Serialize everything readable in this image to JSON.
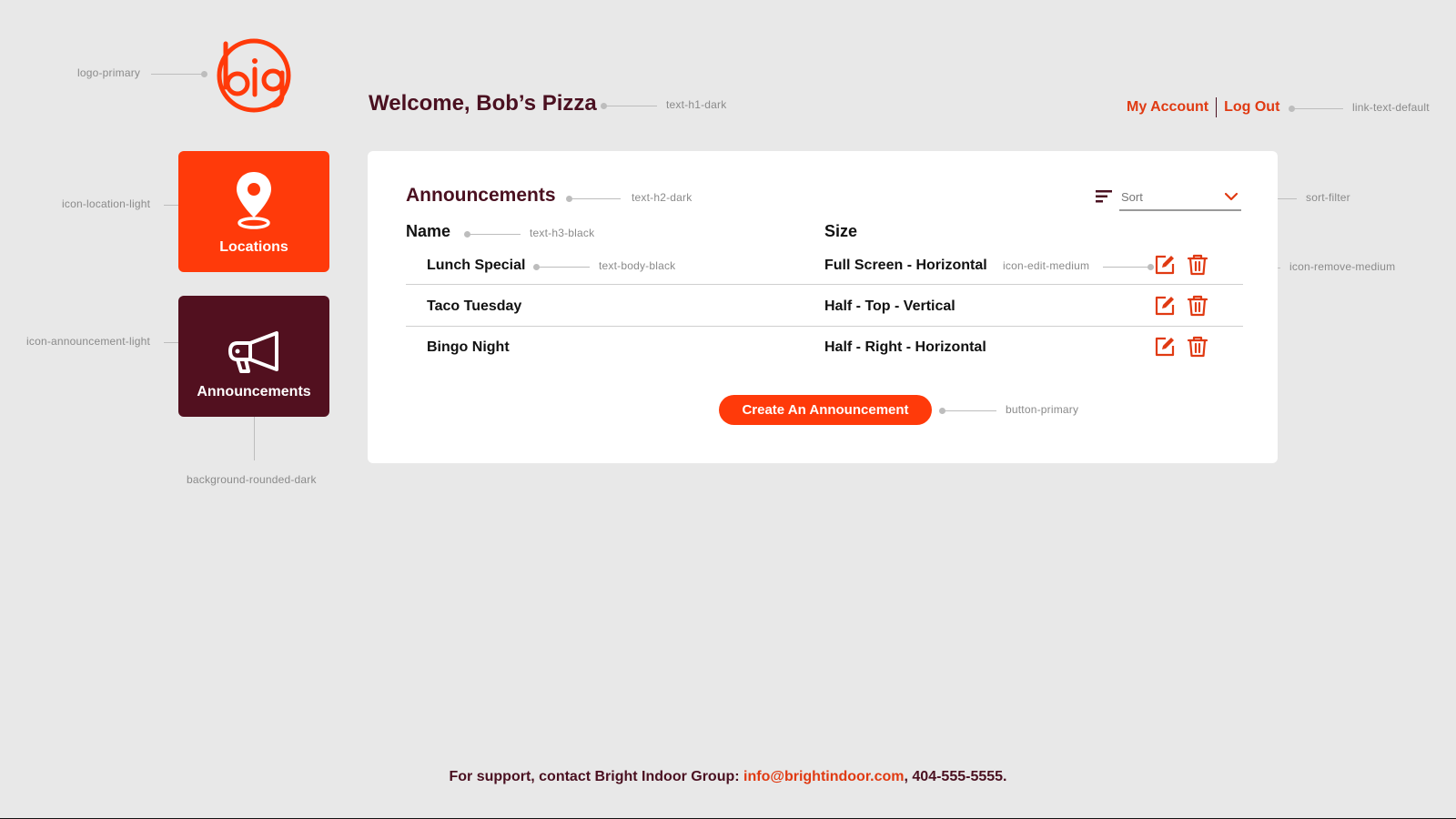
{
  "header": {
    "welcome": "Welcome, Bob’s Pizza",
    "my_account": "My Account",
    "log_out": "Log Out"
  },
  "nav": {
    "locations_label": "Locations",
    "announcements_label": "Announcements"
  },
  "card": {
    "title": "Announcements",
    "sort_label": "Sort",
    "columns": {
      "name": "Name",
      "size": "Size"
    },
    "rows": [
      {
        "name": "Lunch Special",
        "size": "Full Screen - Horizontal"
      },
      {
        "name": "Taco Tuesday",
        "size": "Half - Top - Vertical"
      },
      {
        "name": "Bingo Night",
        "size": "Half - Right - Horizontal"
      }
    ],
    "create_button": "Create An Announcement"
  },
  "annotations": {
    "logo": "logo-primary",
    "h1": "text-h1-dark",
    "link": "link-text-default",
    "location_icon": "icon-location-light",
    "announcement_icon": "icon-announcement-light",
    "background": "background-rounded-dark",
    "h2": "text-h2-dark",
    "sort": "sort-filter",
    "h3": "text-h3-black",
    "body": "text-body-black",
    "edit": "icon-edit-medium",
    "remove": "icon-remove-medium",
    "button": "button-primary"
  },
  "footer": {
    "prefix": "For support, contact Bright Indoor Group: ",
    "email": "info@brightindoor.com",
    "suffix": ", 404-555-5555."
  },
  "colors": {
    "accent": "#ff3a0a",
    "dark": "#52101f",
    "background": "#e8e8e8"
  }
}
